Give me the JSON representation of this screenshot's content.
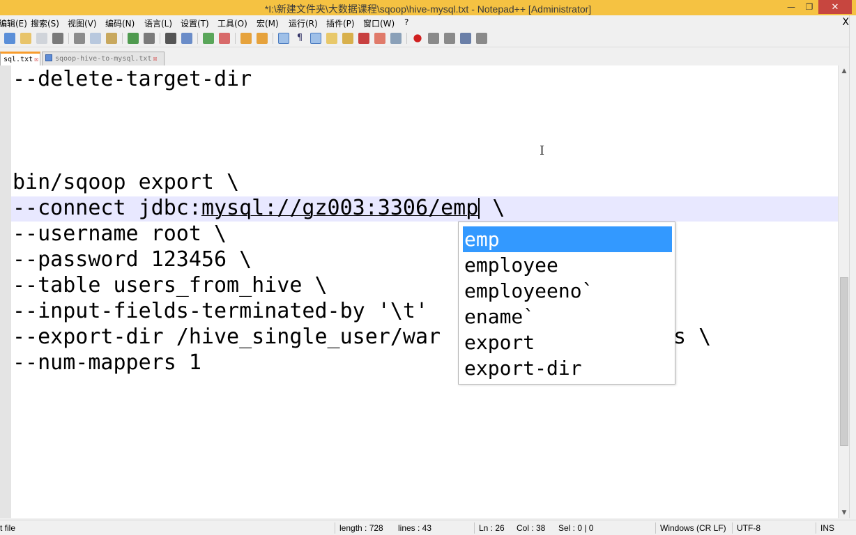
{
  "window": {
    "title": "*I:\\新建文件夹\\大数据课程\\sqoop\\hive-mysql.txt - Notepad++ [Administrator]",
    "minimize_icon": "minimize-icon",
    "maximize_icon": "restore-icon",
    "close_icon": "close-icon"
  },
  "menu": {
    "items": [
      "编辑(E)",
      "搜索(S)",
      "视图(V)",
      "编码(N)",
      "语言(L)",
      "设置(T)",
      "工具(O)",
      "宏(M)",
      "运行(R)",
      "插件(P)",
      "窗口(W)",
      "?"
    ],
    "close_doc": "X"
  },
  "tabs": [
    {
      "label": "sql.txt",
      "active": true
    },
    {
      "label": "sqoop-hive-to-mysql.txt",
      "active": false
    }
  ],
  "editor": {
    "lines": [
      "--delete-target-dir",
      "",
      "",
      "",
      "bin/sqoop export \\",
      "--connect jdbc:mysql://gz003:3306/emp \\",
      "--username root \\",
      "--password 123456 \\",
      "--table users_from_hive \\",
      "--input-fields-terminated-by '\\t' \\",
      "--export-dir /hive_single_user/warehouse/users_from_hive \\",
      "--num-mappers 1"
    ],
    "current_line_parts": {
      "prefix": "--connect jdbc:",
      "underlined": "mysql://gz003:3306/emp",
      "suffix": " \\"
    },
    "export_dir_parts": {
      "left": "--export-dir /hive_single_user/war",
      "right": "s \\"
    },
    "input_fields_visible": "--input-fields-terminated-by '\\t'"
  },
  "autocomplete": {
    "items": [
      "emp",
      "employee",
      "employeeno`",
      "ename`",
      "export",
      "export-dir"
    ],
    "selected_index": 0
  },
  "statusbar": {
    "file_type": "t file",
    "length": "length : 728",
    "lines": "lines : 43",
    "ln": "Ln : 26",
    "col": "Col : 38",
    "sel": "Sel : 0 | 0",
    "eol": "Windows (CR LF)",
    "encoding": "UTF-8",
    "mode": "INS"
  },
  "colors": {
    "titlebar": "#f5c242",
    "selection": "#3399ff",
    "current_line": "#e8e8ff",
    "tab_accent": "#f89c2c"
  }
}
